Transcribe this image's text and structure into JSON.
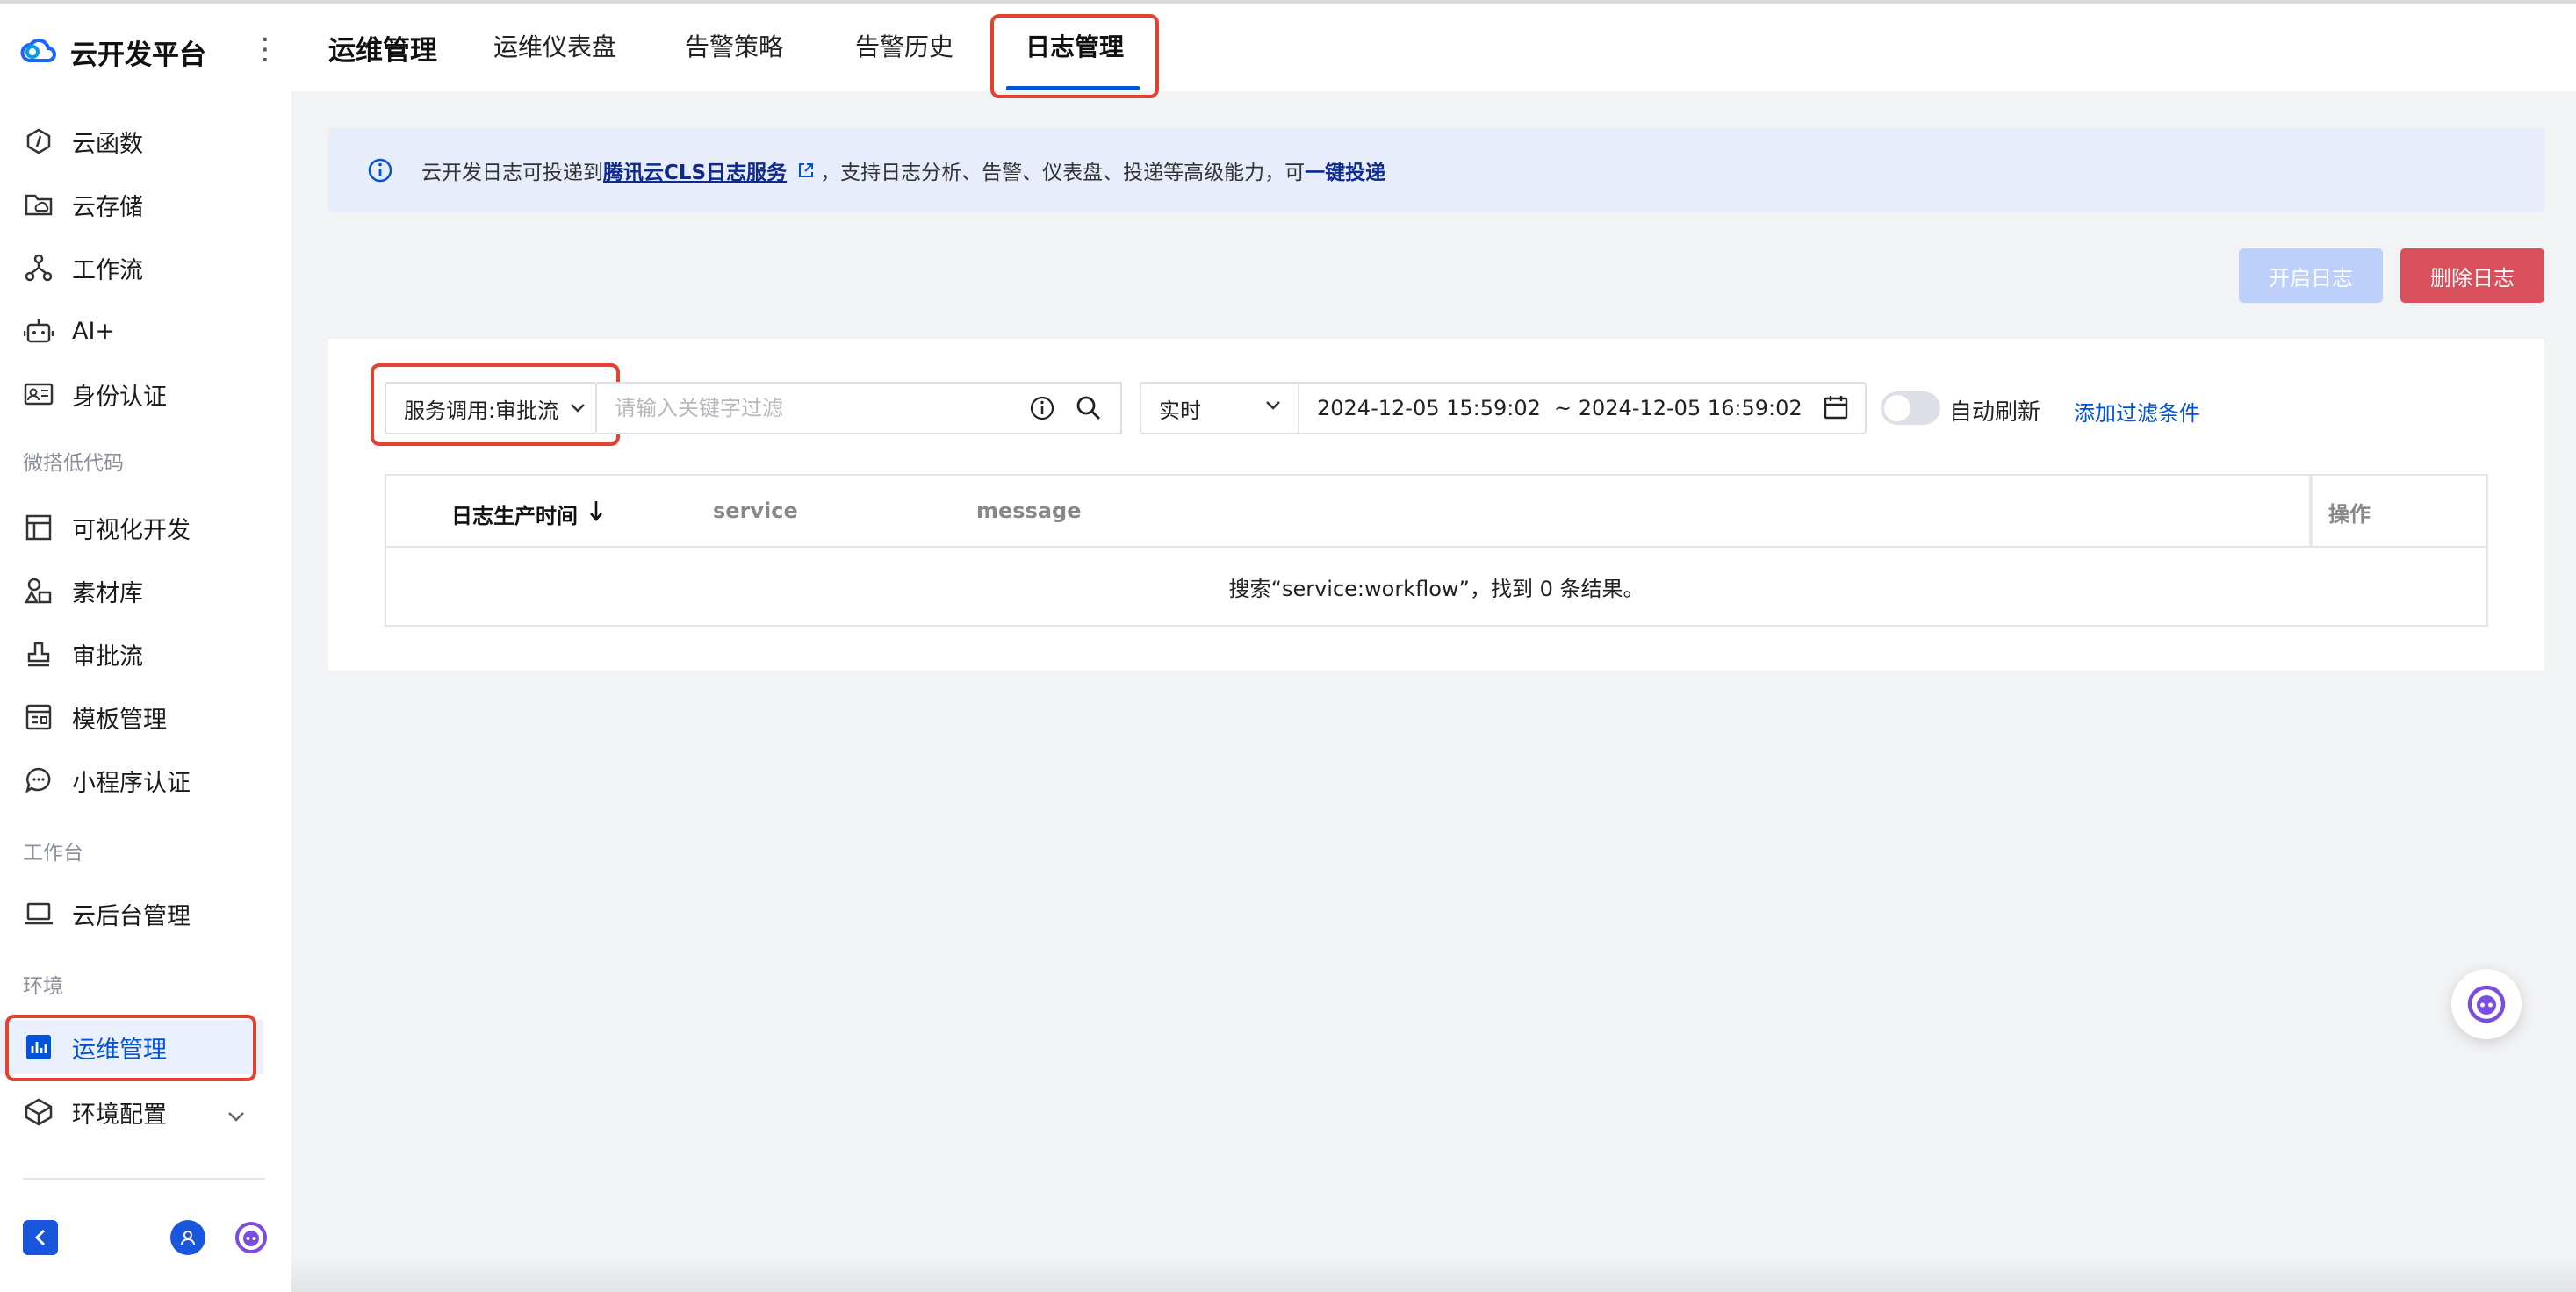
{
  "sidebar": {
    "brand": "云开发平台",
    "items_top": [
      {
        "label": "云函数",
        "icon": "function-icon"
      },
      {
        "label": "云存储",
        "icon": "folder-cloud-icon"
      },
      {
        "label": "工作流",
        "icon": "workflow-icon"
      },
      {
        "label": "AI+",
        "icon": "robot-icon"
      },
      {
        "label": "身份认证",
        "icon": "id-card-icon"
      }
    ],
    "section_lowcode": "微搭低代码",
    "items_lowcode": [
      {
        "label": "可视化开发",
        "icon": "layout-icon"
      },
      {
        "label": "素材库",
        "icon": "shapes-icon"
      },
      {
        "label": "审批流",
        "icon": "stamp-icon"
      },
      {
        "label": "模板管理",
        "icon": "template-icon"
      },
      {
        "label": "小程序认证",
        "icon": "chat-bubble-icon"
      }
    ],
    "section_workbench": "工作台",
    "items_workbench": [
      {
        "label": "云后台管理",
        "icon": "laptop-icon"
      }
    ],
    "section_env": "环境",
    "items_env": [
      {
        "label": "运维管理",
        "icon": "bar-chart-icon",
        "active": true
      },
      {
        "label": "环境配置",
        "icon": "cube-icon"
      }
    ]
  },
  "header": {
    "title": "运维管理",
    "tabs": [
      {
        "label": "运维仪表盘"
      },
      {
        "label": "告警策略"
      },
      {
        "label": "告警历史"
      },
      {
        "label": "日志管理",
        "active": true
      }
    ]
  },
  "info": {
    "prefix": "云开发日志可投递到",
    "link": "腾讯云CLS日志服务",
    "middle": "，支持日志分析、告警、仪表盘、投递等高级能力，可",
    "action": "一键投递"
  },
  "buttons": {
    "enable": "开启日志",
    "delete": "删除日志"
  },
  "filter": {
    "service_select": "服务调用:审批流",
    "search_placeholder": "请输入关键字过滤",
    "mode": "实时",
    "start": "2024-12-05 15:59:02",
    "end": "~ 2024-12-05 16:59:02",
    "auto_refresh": "自动刷新",
    "add_filter": "添加过滤条件"
  },
  "table": {
    "columns": [
      "日志生产时间",
      "service",
      "message"
    ],
    "op": "操作",
    "empty": "搜索“service:workflow”，找到 0 条结果。"
  },
  "colors": {
    "accent": "#0052d9",
    "danger": "#d8505b",
    "highlight": "#e5412f"
  }
}
